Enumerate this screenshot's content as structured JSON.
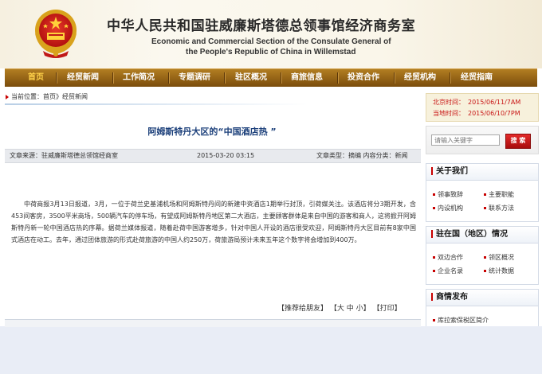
{
  "header": {
    "title_cn": "中华人民共和国驻威廉斯塔德总领事馆经济商务室",
    "title_en_line1": "Economic and Commercial Section of the Consulate General of",
    "title_en_line2": "the People's Republic of China in Willemstad"
  },
  "nav": {
    "items": [
      {
        "label": "首页",
        "active": true
      },
      {
        "label": "经贸新闻"
      },
      {
        "label": "工作简况"
      },
      {
        "label": "专题调研"
      },
      {
        "label": "驻区概况"
      },
      {
        "label": "商旅信息"
      },
      {
        "label": "投资合作"
      },
      {
        "label": "经贸机构"
      },
      {
        "label": "经贸指南"
      }
    ]
  },
  "breadcrumb": {
    "label": "当前位置：",
    "home": "首页",
    "sep": "》",
    "current": "经贸新闻"
  },
  "article": {
    "title": "阿姆斯特丹大区的“中国酒店热  ”",
    "source": "文章来源：驻威廉斯塔德总领馆经商室",
    "date": "2015-03-20 03:15",
    "type": "文章类型：摘编  内容分类：新闻",
    "body": "中荷商报3月13日报道，3月，一位于荷兰史基浦机场和阿姆斯特丹间的新建中资酒店1期举行封顶，引荷媒关注。该酒店将分3期开发，含453间客房，3500平米商场，500辆汽车的停车场，有望成阿姆斯特丹地区第二大酒店，主要顾客群体是来自中国的游客和商人，这将掀开阿姆斯特丹新一轮中国酒店热的序幕。据荷兰媒体报道，随着赴荷中国游客增多，针对中国人开设的酒店很受欢迎，阿姆斯特丹大区目前有8家中国式酒店在动工。去年，通过团体旅游的形式赴荷旅游的中国人约250万，荷旅游局预计未来五年这个数字将会增加到400万。",
    "tools": {
      "recommend": "【推荐给朋友】",
      "font_big": "【大",
      "font_mid": "中",
      "font_small": "小】",
      "print": "【打印】"
    }
  },
  "sidebar": {
    "time": {
      "beijing_label": "北京时间：",
      "beijing_value": "2015/06/11/7AM",
      "local_label": "当地时间：",
      "local_value": "2015/06/10/7PM"
    },
    "search": {
      "placeholder": "请输入关键字",
      "button": "搜 索"
    },
    "about": {
      "title": "关于我们",
      "links": [
        "领事致辞",
        "主要职能",
        "内设机构",
        "联系方法"
      ]
    },
    "region": {
      "title": "驻在国（地区）情况",
      "links": [
        "双边合作",
        "领区概况",
        "企业名录",
        "统计数据"
      ]
    },
    "business": {
      "title": "商情发布",
      "links": [
        "库拉索保税区简介"
      ]
    }
  },
  "colors": {
    "nav_bg": "#8b5a12",
    "nav_active": "#ffd24a",
    "title_blue": "#1b3f7a",
    "accent_red": "#c80000"
  }
}
